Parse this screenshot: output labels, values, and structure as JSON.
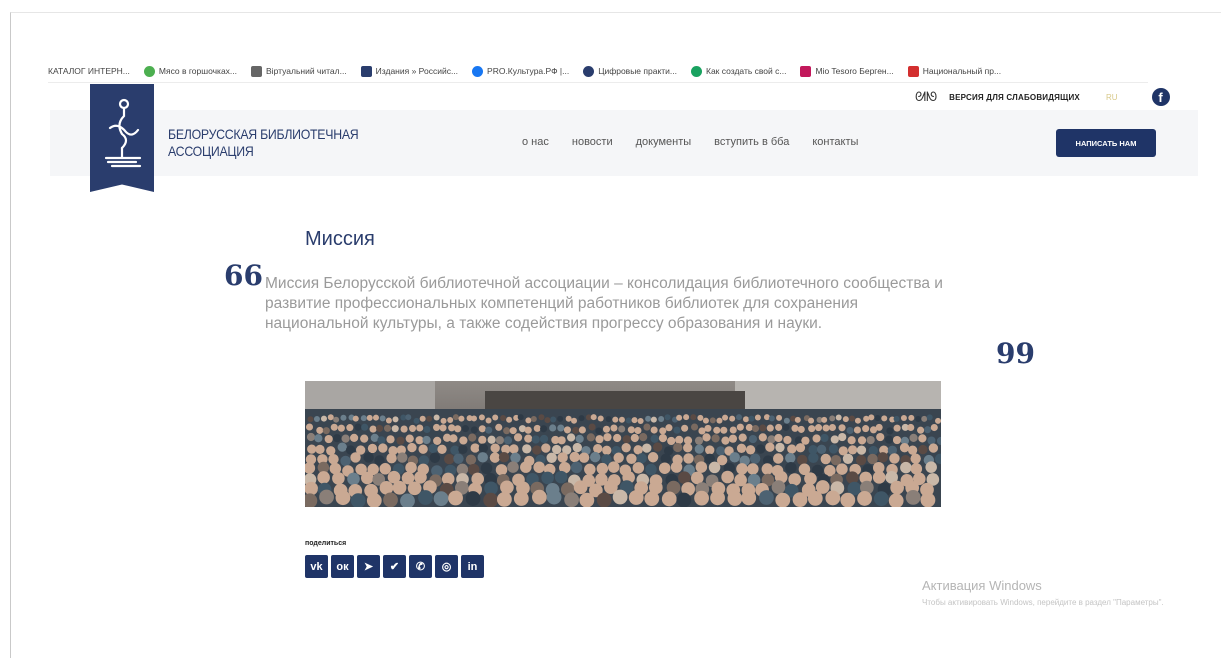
{
  "bookmarks": [
    {
      "label": "КАТАЛОГ ИНТЕРН...",
      "icon": "none"
    },
    {
      "label": "Мясо в горшочках...",
      "icon": "green-circle-icon",
      "color": "#4caf50"
    },
    {
      "label": "Віртуальний читал...",
      "icon": "book-icon",
      "color": "#666666"
    },
    {
      "label": "Издания » Российс...",
      "icon": "library-icon",
      "color": "#2a3d6d"
    },
    {
      "label": "PRO.Культура.РФ |...",
      "icon": "blue-circle-icon",
      "color": "#1877f2"
    },
    {
      "label": "Цифровые практи...",
      "icon": "globe-icon",
      "color": "#2a3d6d"
    },
    {
      "label": "Как создать свой с...",
      "icon": "c-icon",
      "color": "#1aa260"
    },
    {
      "label": "Mio Tesoro Берген...",
      "icon": "flag-icon",
      "color": "#c2185b"
    },
    {
      "label": "Национальный пр...",
      "icon": "red-square-icon",
      "color": "#d32f2f"
    }
  ],
  "util": {
    "low_vision": "ВЕРСИЯ ДЛЯ СЛАБОВИДЯЩИХ",
    "lang": "RU",
    "fb": "f"
  },
  "header": {
    "name_line1": "БЕЛОРУССКАЯ БИБЛИОТЕЧНАЯ",
    "name_line2": "АССОЦИАЦИЯ",
    "nav": [
      "о нас",
      "новости",
      "документы",
      "вступить в бба",
      "контакты"
    ],
    "write_button": "НАПИСАТЬ НАМ"
  },
  "content": {
    "title": "Миссия",
    "quote_open": "66",
    "quote_close": "99",
    "mission_text": "Миссия Белорусской библиотечной ассоциации – консолидация библиотечного сообщества и развитие профессиональных компетенций работников библиотек для сохранения национальной культуры, а также содействия прогрессу образования и науки."
  },
  "share": {
    "label": "поделиться",
    "buttons": [
      {
        "name": "vk-icon",
        "glyph": "vk"
      },
      {
        "name": "odnoklassniki-icon",
        "glyph": "ок"
      },
      {
        "name": "telegram-icon",
        "glyph": "➤"
      },
      {
        "name": "twitter-icon",
        "glyph": "✔"
      },
      {
        "name": "viber-icon",
        "glyph": "✆"
      },
      {
        "name": "whatsapp-icon",
        "glyph": "◎"
      },
      {
        "name": "linkedin-icon",
        "glyph": "in"
      }
    ]
  },
  "windows": {
    "title": "Активация Windows",
    "subtitle": "Чтобы активировать Windows, перейдите в раздел \"Параметры\"."
  },
  "colors": {
    "brand": "#2a3d6d",
    "button": "#1f3467",
    "text_muted": "#9a9a9a"
  }
}
